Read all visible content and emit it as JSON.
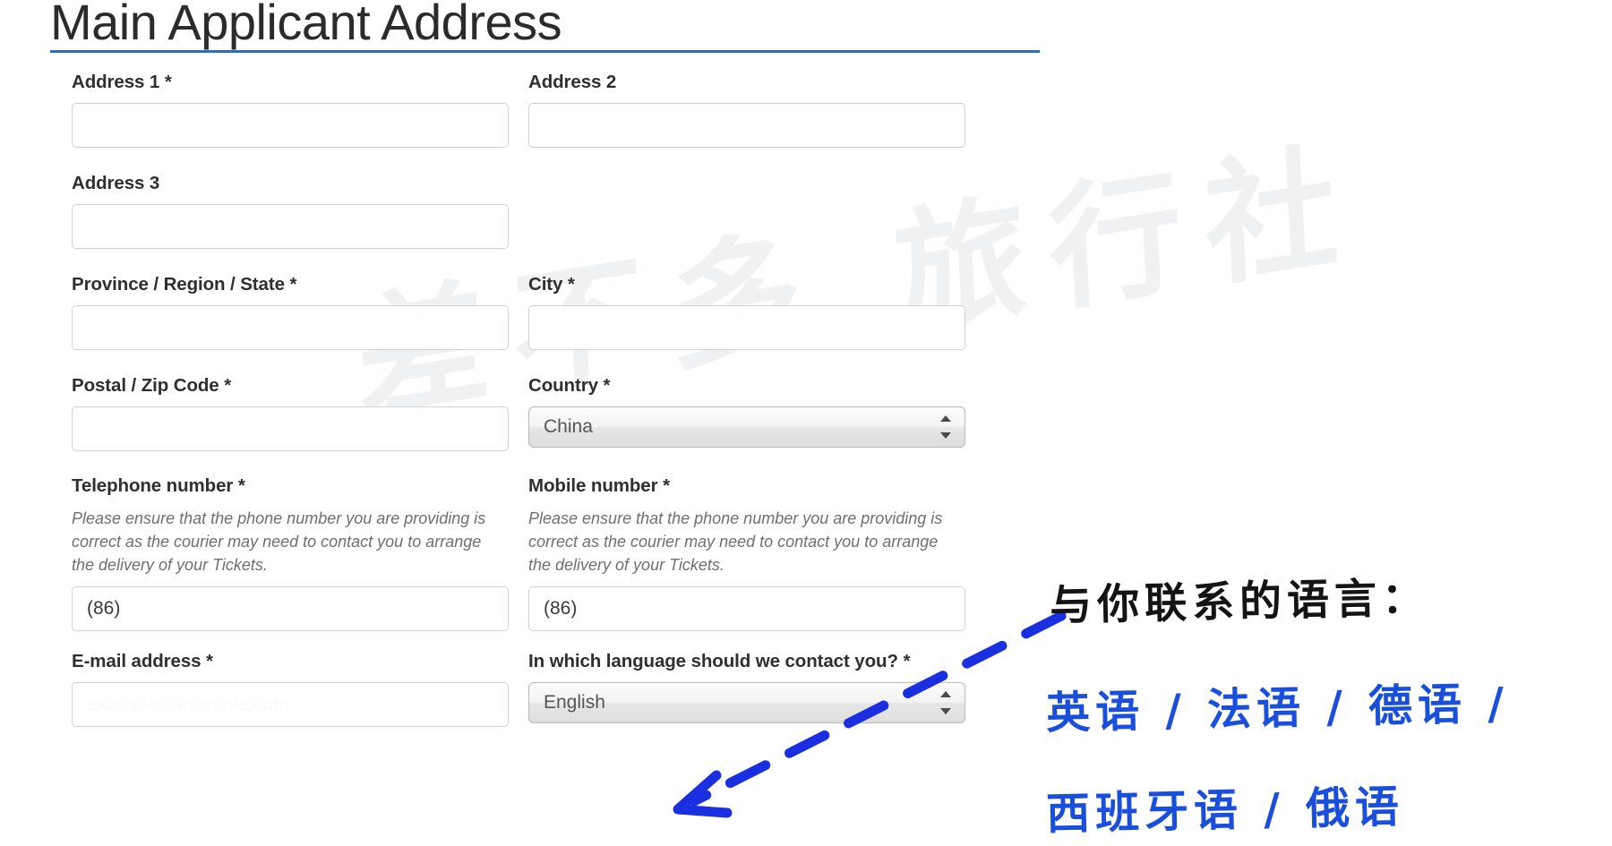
{
  "page": {
    "title": "Main Applicant Address",
    "watermark": "差不多 旅行社",
    "accent_color": "#2a6ebb",
    "annotation_blue": "#1a4fdb"
  },
  "form": {
    "fields": [
      {
        "key": "address1",
        "label": "Address 1 *",
        "type": "text",
        "value": "",
        "placeholder": ""
      },
      {
        "key": "address2",
        "label": "Address 2",
        "type": "text",
        "value": "",
        "placeholder": ""
      },
      {
        "key": "address3",
        "label": "Address 3",
        "type": "text",
        "value": "",
        "placeholder": ""
      },
      {
        "key": "province",
        "label": "Province / Region / State *",
        "type": "text",
        "value": "",
        "placeholder": ""
      },
      {
        "key": "city",
        "label": "City *",
        "type": "text",
        "value": "",
        "placeholder": ""
      },
      {
        "key": "postal",
        "label": "Postal / Zip Code *",
        "type": "text",
        "value": "",
        "placeholder": ""
      },
      {
        "key": "country",
        "label": "Country *",
        "type": "select",
        "value": "China"
      },
      {
        "key": "telephone",
        "label": "Telephone number *",
        "help": "Please ensure that the phone number you are providing is correct as the courier may need to contact you to arrange the delivery of your Tickets.",
        "type": "text",
        "value": "(86)"
      },
      {
        "key": "mobile",
        "label": "Mobile number *",
        "help": "Please ensure that the phone number you are providing is correct as the courier may need to contact you to arrange the delivery of your Tickets.",
        "type": "text",
        "value": "(86)"
      },
      {
        "key": "email",
        "label": "E-mail address *",
        "type": "text",
        "value": "",
        "placeholder": "example@example.com"
      },
      {
        "key": "language",
        "label": "In which language should we contact you? *",
        "type": "select",
        "value": "English"
      }
    ]
  },
  "annotations": {
    "line1": "与你联系的语言：",
    "line2": "英语 / 法语 / 德语 /",
    "line3": "西班牙语 / 俄语",
    "arrow_name": "arrow-pointing-to-language-select"
  }
}
